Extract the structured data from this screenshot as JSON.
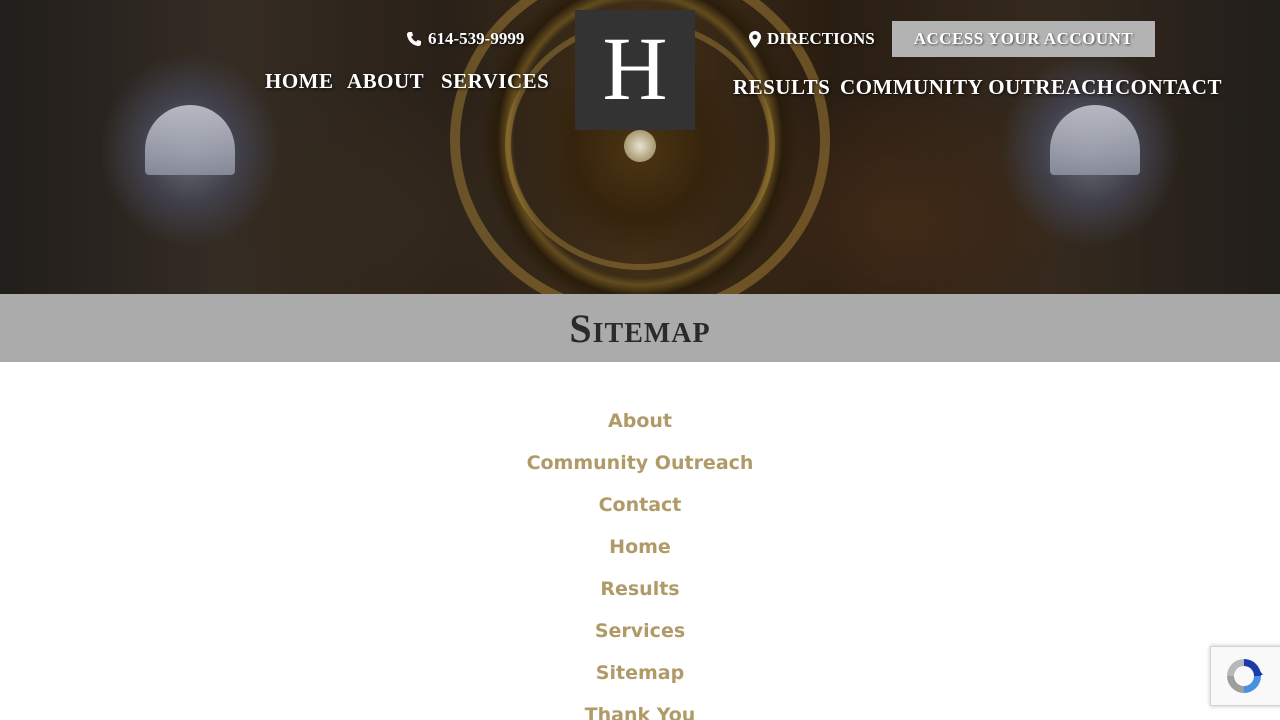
{
  "header": {
    "logo_letter": "H",
    "phone": "614-539-9999",
    "directions": "DIRECTIONS",
    "account_button": "ACCESS YOUR ACCOUNT",
    "nav_left": [
      "HOME",
      "ABOUT",
      "SERVICES"
    ],
    "nav_right": [
      "RESULTS",
      "COMMUNITY OUTREACH",
      "CONTACT"
    ]
  },
  "page": {
    "title": "Sitemap"
  },
  "sitemap": {
    "items": [
      "About",
      "Community Outreach",
      "Contact",
      "Home",
      "Results",
      "Services",
      "Sitemap",
      "Thank You"
    ]
  },
  "icons": {
    "phone": "phone-icon",
    "directions": "map-pin-icon",
    "recaptcha": "recaptcha-icon"
  },
  "colors": {
    "link": "#b09a68",
    "title_bar": "#ababab",
    "logo_bg": "#333333",
    "account_button": "#b3b3b3"
  }
}
